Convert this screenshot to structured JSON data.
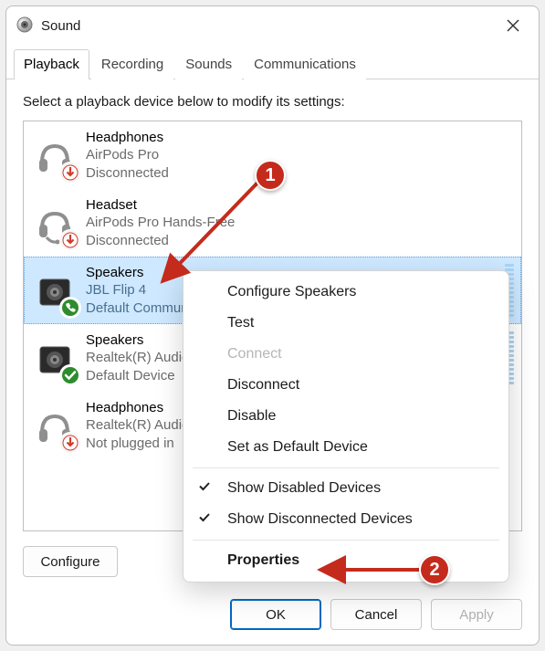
{
  "window": {
    "title": "Sound"
  },
  "tabs": [
    "Playback",
    "Recording",
    "Sounds",
    "Communications"
  ],
  "active_tab": 0,
  "instruction": "Select a playback device below to modify its settings:",
  "devices": [
    {
      "name": "Headphones",
      "sub1": "AirPods Pro",
      "sub2": "Disconnected",
      "kind": "headphones",
      "status": "disconnected",
      "selected": false,
      "meter": false
    },
    {
      "name": "Headset",
      "sub1": "AirPods Pro Hands-Free",
      "sub2": "Disconnected",
      "kind": "headset",
      "status": "disconnected",
      "selected": false,
      "meter": false
    },
    {
      "name": "Speakers",
      "sub1": "JBL Flip 4",
      "sub2": "Default Communications Device",
      "kind": "speaker-dark",
      "status": "ready",
      "selected": true,
      "meter": true
    },
    {
      "name": "Speakers",
      "sub1": "Realtek(R) Audio",
      "sub2": "Default Device",
      "kind": "speaker-dark",
      "status": "default",
      "selected": false,
      "meter": true
    },
    {
      "name": "Headphones",
      "sub1": "Realtek(R) Audio",
      "sub2": "Not plugged in",
      "kind": "headphones",
      "status": "disconnected",
      "selected": false,
      "meter": false
    }
  ],
  "context_menu": {
    "items": [
      {
        "label": "Configure Speakers",
        "enabled": true
      },
      {
        "label": "Test",
        "enabled": true
      },
      {
        "label": "Connect",
        "enabled": false
      },
      {
        "label": "Disconnect",
        "enabled": true
      },
      {
        "label": "Disable",
        "enabled": true
      },
      {
        "label": "Set as Default Device",
        "enabled": true
      }
    ],
    "toggles": [
      {
        "label": "Show Disabled Devices",
        "checked": true
      },
      {
        "label": "Show Disconnected Devices",
        "checked": true
      }
    ],
    "final": {
      "label": "Properties",
      "bold": true
    }
  },
  "buttons": {
    "configure": "Configure",
    "ok": "OK",
    "cancel": "Cancel",
    "apply": "Apply"
  },
  "annotations": {
    "step1": "1",
    "step2": "2"
  }
}
